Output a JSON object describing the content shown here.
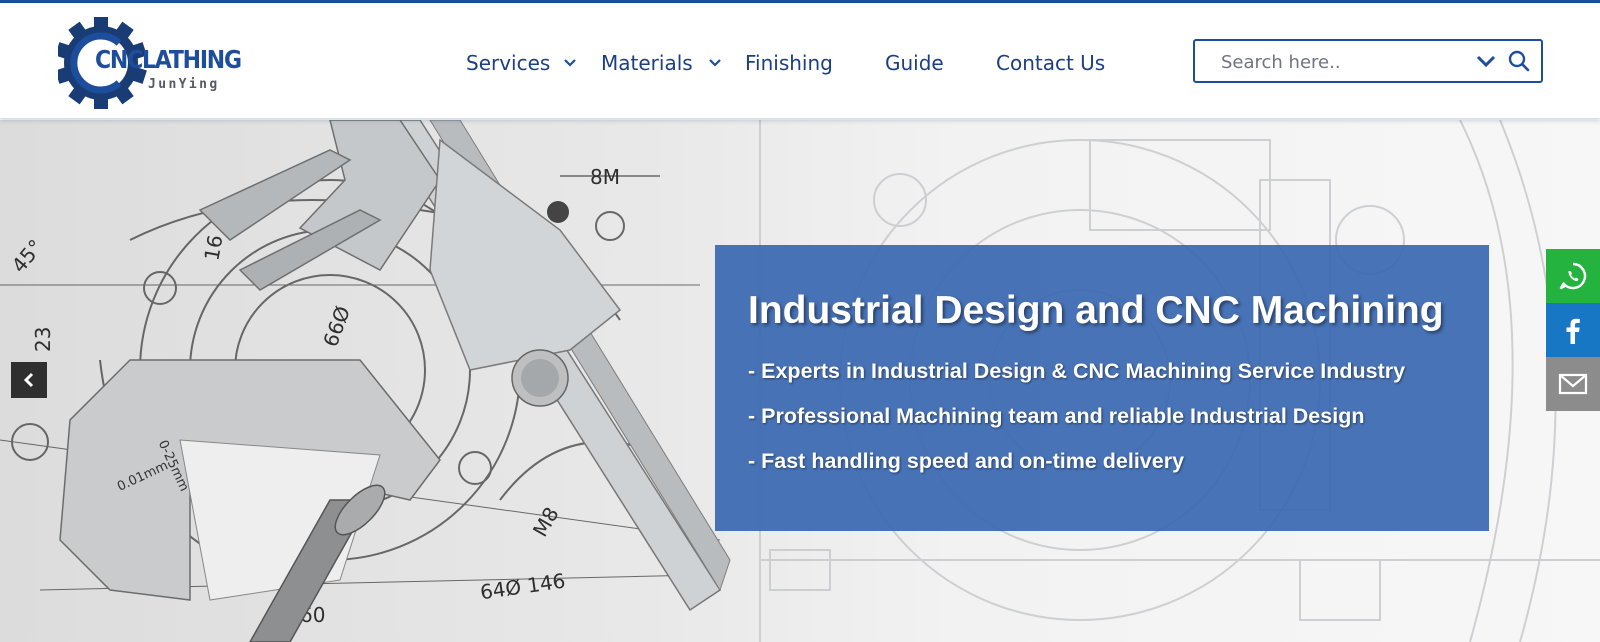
{
  "brand": {
    "name": "CNCLATHING",
    "sub": "JunYing",
    "primary_color": "#1d4e9e"
  },
  "nav": {
    "items": [
      {
        "label": "Services",
        "has_dropdown": true
      },
      {
        "label": "Materials",
        "has_dropdown": true
      },
      {
        "label": "Finishing",
        "has_dropdown": false
      },
      {
        "label": "Guide",
        "has_dropdown": false
      },
      {
        "label": "Contact Us",
        "has_dropdown": false
      }
    ]
  },
  "search": {
    "placeholder": "Search here..",
    "icon": "search-icon",
    "dropdown_icon": "chevron-down-icon"
  },
  "hero": {
    "title": "Industrial Design and CNC Machining",
    "bullets": [
      "- Experts in Industrial Design & CNC Machining Service Industry",
      "- Professional Machining team and reliable Industrial Design",
      "- Fast handling speed and on-time delivery"
    ],
    "panel_color": "#3a68b2",
    "prev_icon": "chevron-left-icon"
  },
  "social": {
    "items": [
      {
        "name": "whatsapp",
        "icon": "whatsapp-icon",
        "color": "#25b340"
      },
      {
        "name": "facebook",
        "icon": "facebook-icon",
        "color": "#1877c5"
      },
      {
        "name": "email",
        "icon": "mail-icon",
        "color": "#8c8c8c"
      }
    ]
  }
}
